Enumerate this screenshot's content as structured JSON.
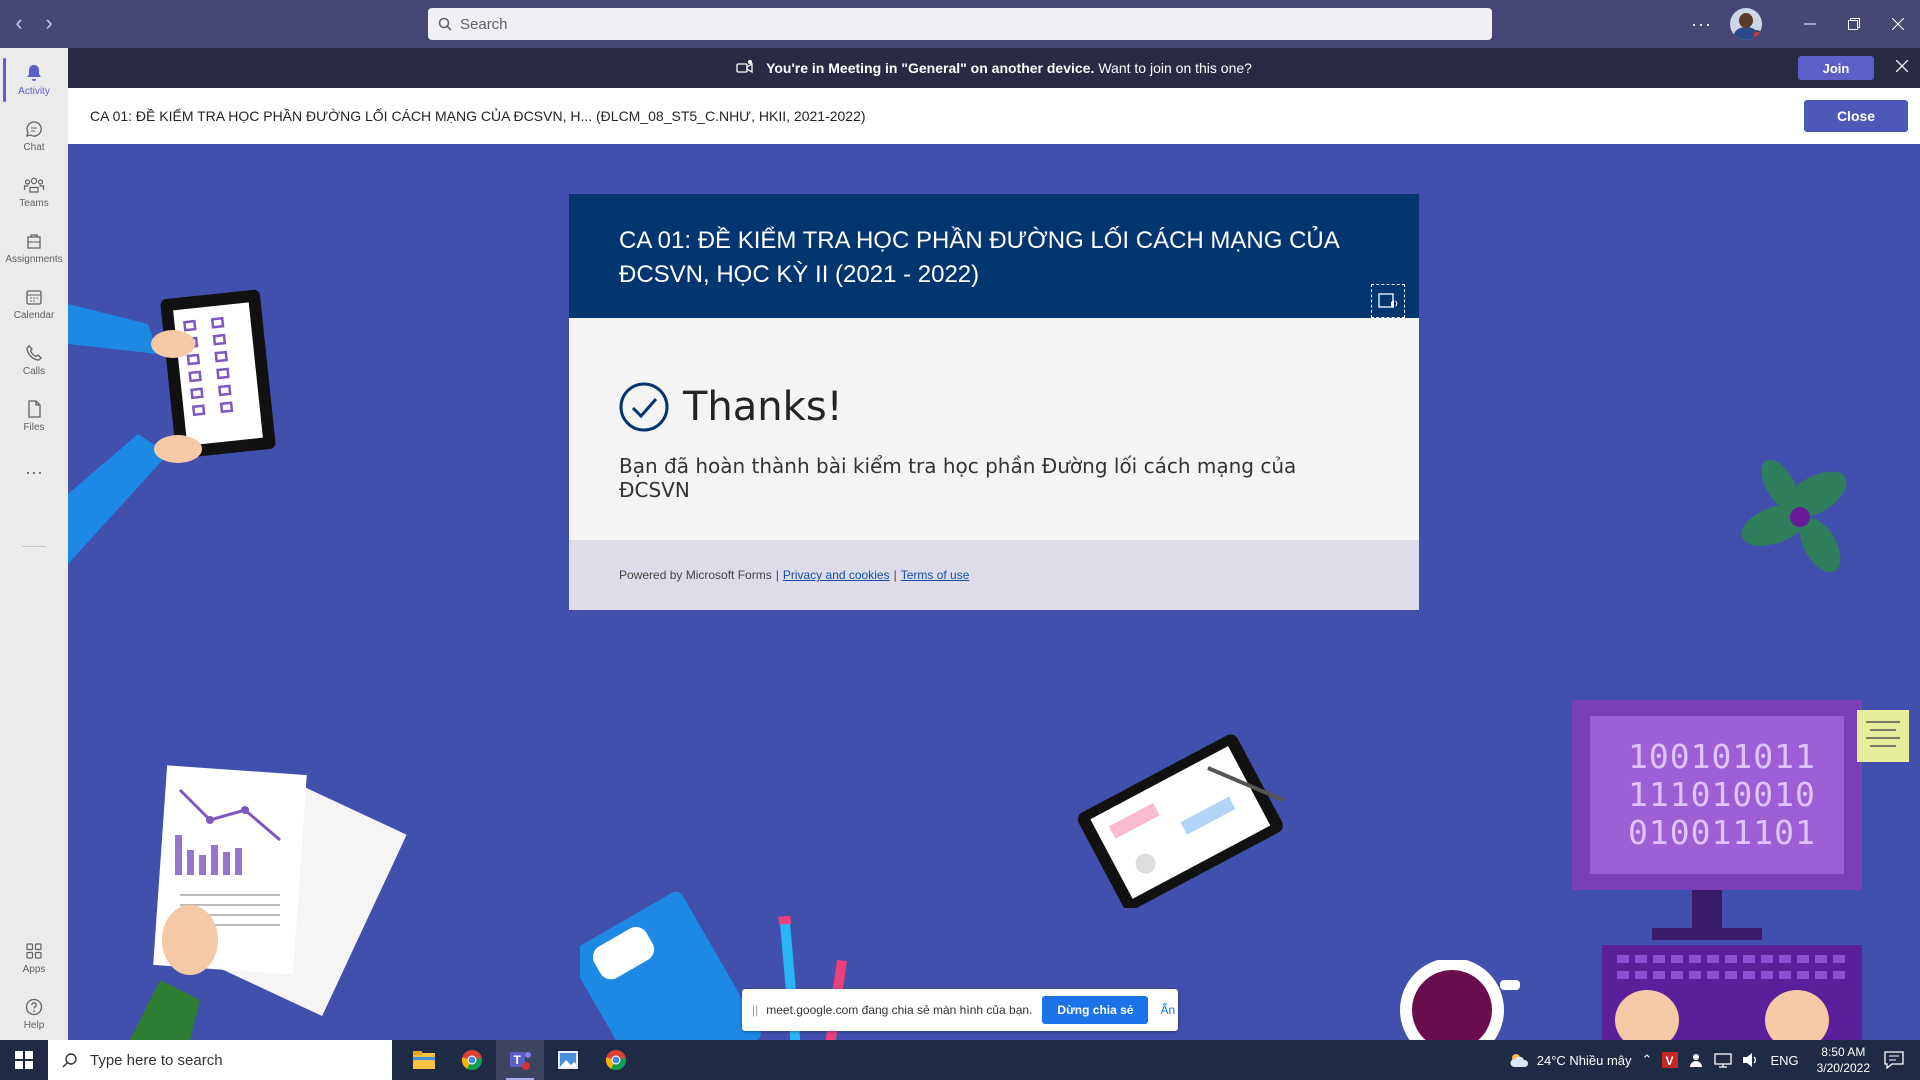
{
  "titlebar": {
    "search_placeholder": "Search",
    "more": "···"
  },
  "rail": {
    "items": [
      {
        "label": "Activity",
        "icon": "bell-icon"
      },
      {
        "label": "Chat",
        "icon": "chat-icon"
      },
      {
        "label": "Teams",
        "icon": "teams-icon"
      },
      {
        "label": "Assignments",
        "icon": "assignments-icon"
      },
      {
        "label": "Calendar",
        "icon": "calendar-icon"
      },
      {
        "label": "Calls",
        "icon": "phone-icon"
      },
      {
        "label": "Files",
        "icon": "file-icon"
      }
    ],
    "more": "···",
    "bottom": [
      {
        "label": "Apps",
        "icon": "apps-icon"
      },
      {
        "label": "Help",
        "icon": "help-icon"
      }
    ]
  },
  "banner": {
    "bold": "You're in Meeting in \"General\" on another device.",
    "text": "Want to join on this one?",
    "join": "Join"
  },
  "header": {
    "title": "CA 01: ĐỀ KIỂM TRA HỌC PHẦN ĐƯỜNG LỐI CÁCH MẠNG CỦA ĐCSVN, H... (ĐLCM_08_ST5_C.NHƯ, HKII, 2021-2022)",
    "close": "Close"
  },
  "form": {
    "title_line1": "CA 01: ĐỀ KIỂM TRA HỌC PHẦN ĐƯỜNG LỐI CÁCH MẠNG CỦA",
    "title_line2": "ĐCSVN, HỌC KỲ II (2021 - 2022)",
    "thanks": "Thanks!",
    "message": "Bạn đã hoàn thành bài kiểm tra học phần Đường lối cách mạng của ĐCSVN",
    "powered": "Powered by Microsoft Forms",
    "sep": "|",
    "privacy": "Privacy and cookies",
    "terms": "Terms of use"
  },
  "decor": {
    "binary1": "100101011",
    "binary2": "111010010",
    "binary3": "010011101"
  },
  "sharebar": {
    "grip": "||",
    "text": "meet.google.com đang chia sẻ màn hình của bạn.",
    "stop": "Dừng chia sẻ",
    "hide": "Ẩn"
  },
  "taskbar": {
    "search_placeholder": "Type here to search",
    "weather": "24°C  Nhiều mây",
    "lang": "ENG",
    "time": "8:50 AM",
    "date": "3/20/2022"
  },
  "colors": {
    "teams_purple": "#464775",
    "accent": "#5b5fc7",
    "form_header": "#033671",
    "background": "#4250ad"
  }
}
